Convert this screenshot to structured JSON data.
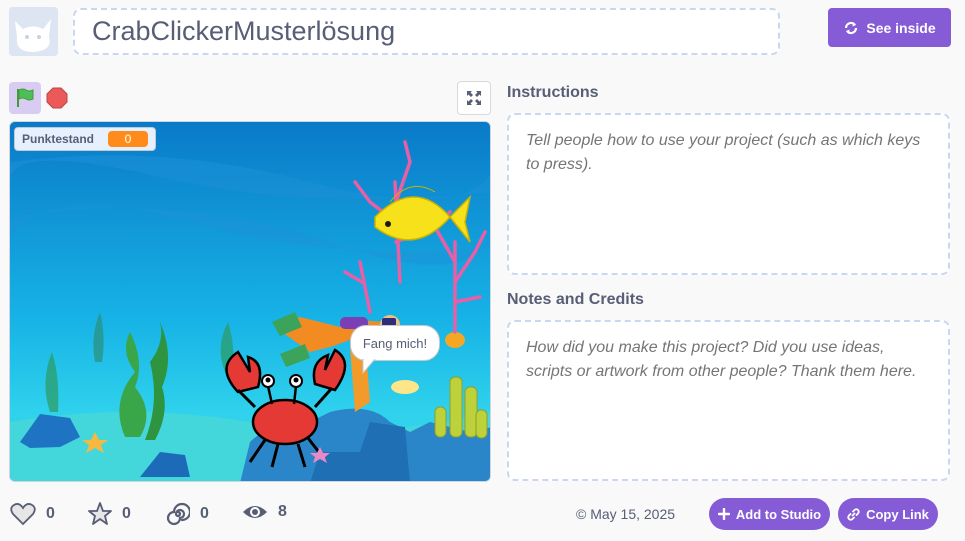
{
  "header": {
    "project_title": "CrabClickerMusterlösung",
    "see_inside_label": "See inside"
  },
  "player": {
    "flag_icon": "green-flag-icon",
    "stop_icon": "stop-icon",
    "fullscreen_icon": "fullscreen-icon",
    "monitor": {
      "label": "Punktestand",
      "value": "0"
    },
    "speech_bubble": "Fang mich!"
  },
  "instructions": {
    "label": "Instructions",
    "placeholder": "Tell people how to use your project (such as which keys to press)."
  },
  "notes": {
    "label": "Notes and Credits",
    "placeholder": "How did you make this project? Did you use ideas, scripts or artwork from other people? Thank them here."
  },
  "stats": {
    "loves": "0",
    "favorites": "0",
    "remixes": "0",
    "views": "8"
  },
  "footer": {
    "date": "© May 15, 2025",
    "add_to_studio_label": "Add to Studio",
    "copy_link_label": "Copy Link"
  },
  "colors": {
    "accent": "#855cd6",
    "monitor_value": "#ff8c1a"
  }
}
